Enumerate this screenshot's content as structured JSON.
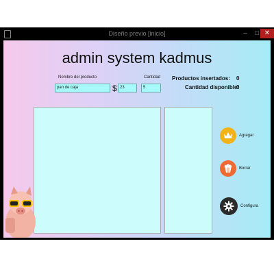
{
  "window": {
    "title": "Diseño previo [inicio]",
    "controls": [
      "–",
      "□",
      "✕"
    ]
  },
  "heading": "admin system kadmus",
  "form": {
    "product_label": "Nombre del producto",
    "product_value": "pan de caja",
    "currency_symbol": "$",
    "price_value": "23",
    "quantity_label": "Cantidad",
    "quantity_value": "5"
  },
  "stats": {
    "inserted_label": "Productos insertados:",
    "inserted_value": "0",
    "available_label": "Cantidad disponible:",
    "available_value": "0"
  },
  "actions": [
    {
      "label": "Agregar",
      "icon": "crown-icon",
      "color": "#f2b21a"
    },
    {
      "label": "Borrar",
      "icon": "popcorn-icon",
      "color": "#ef6a33"
    },
    {
      "label": "Configura",
      "icon": "gear-icon",
      "color": "#2b2b2b"
    }
  ],
  "colors": {
    "field_bg": "#a8fafa",
    "panel_bg": "#cdfcfc",
    "close_button": "#b42020"
  }
}
